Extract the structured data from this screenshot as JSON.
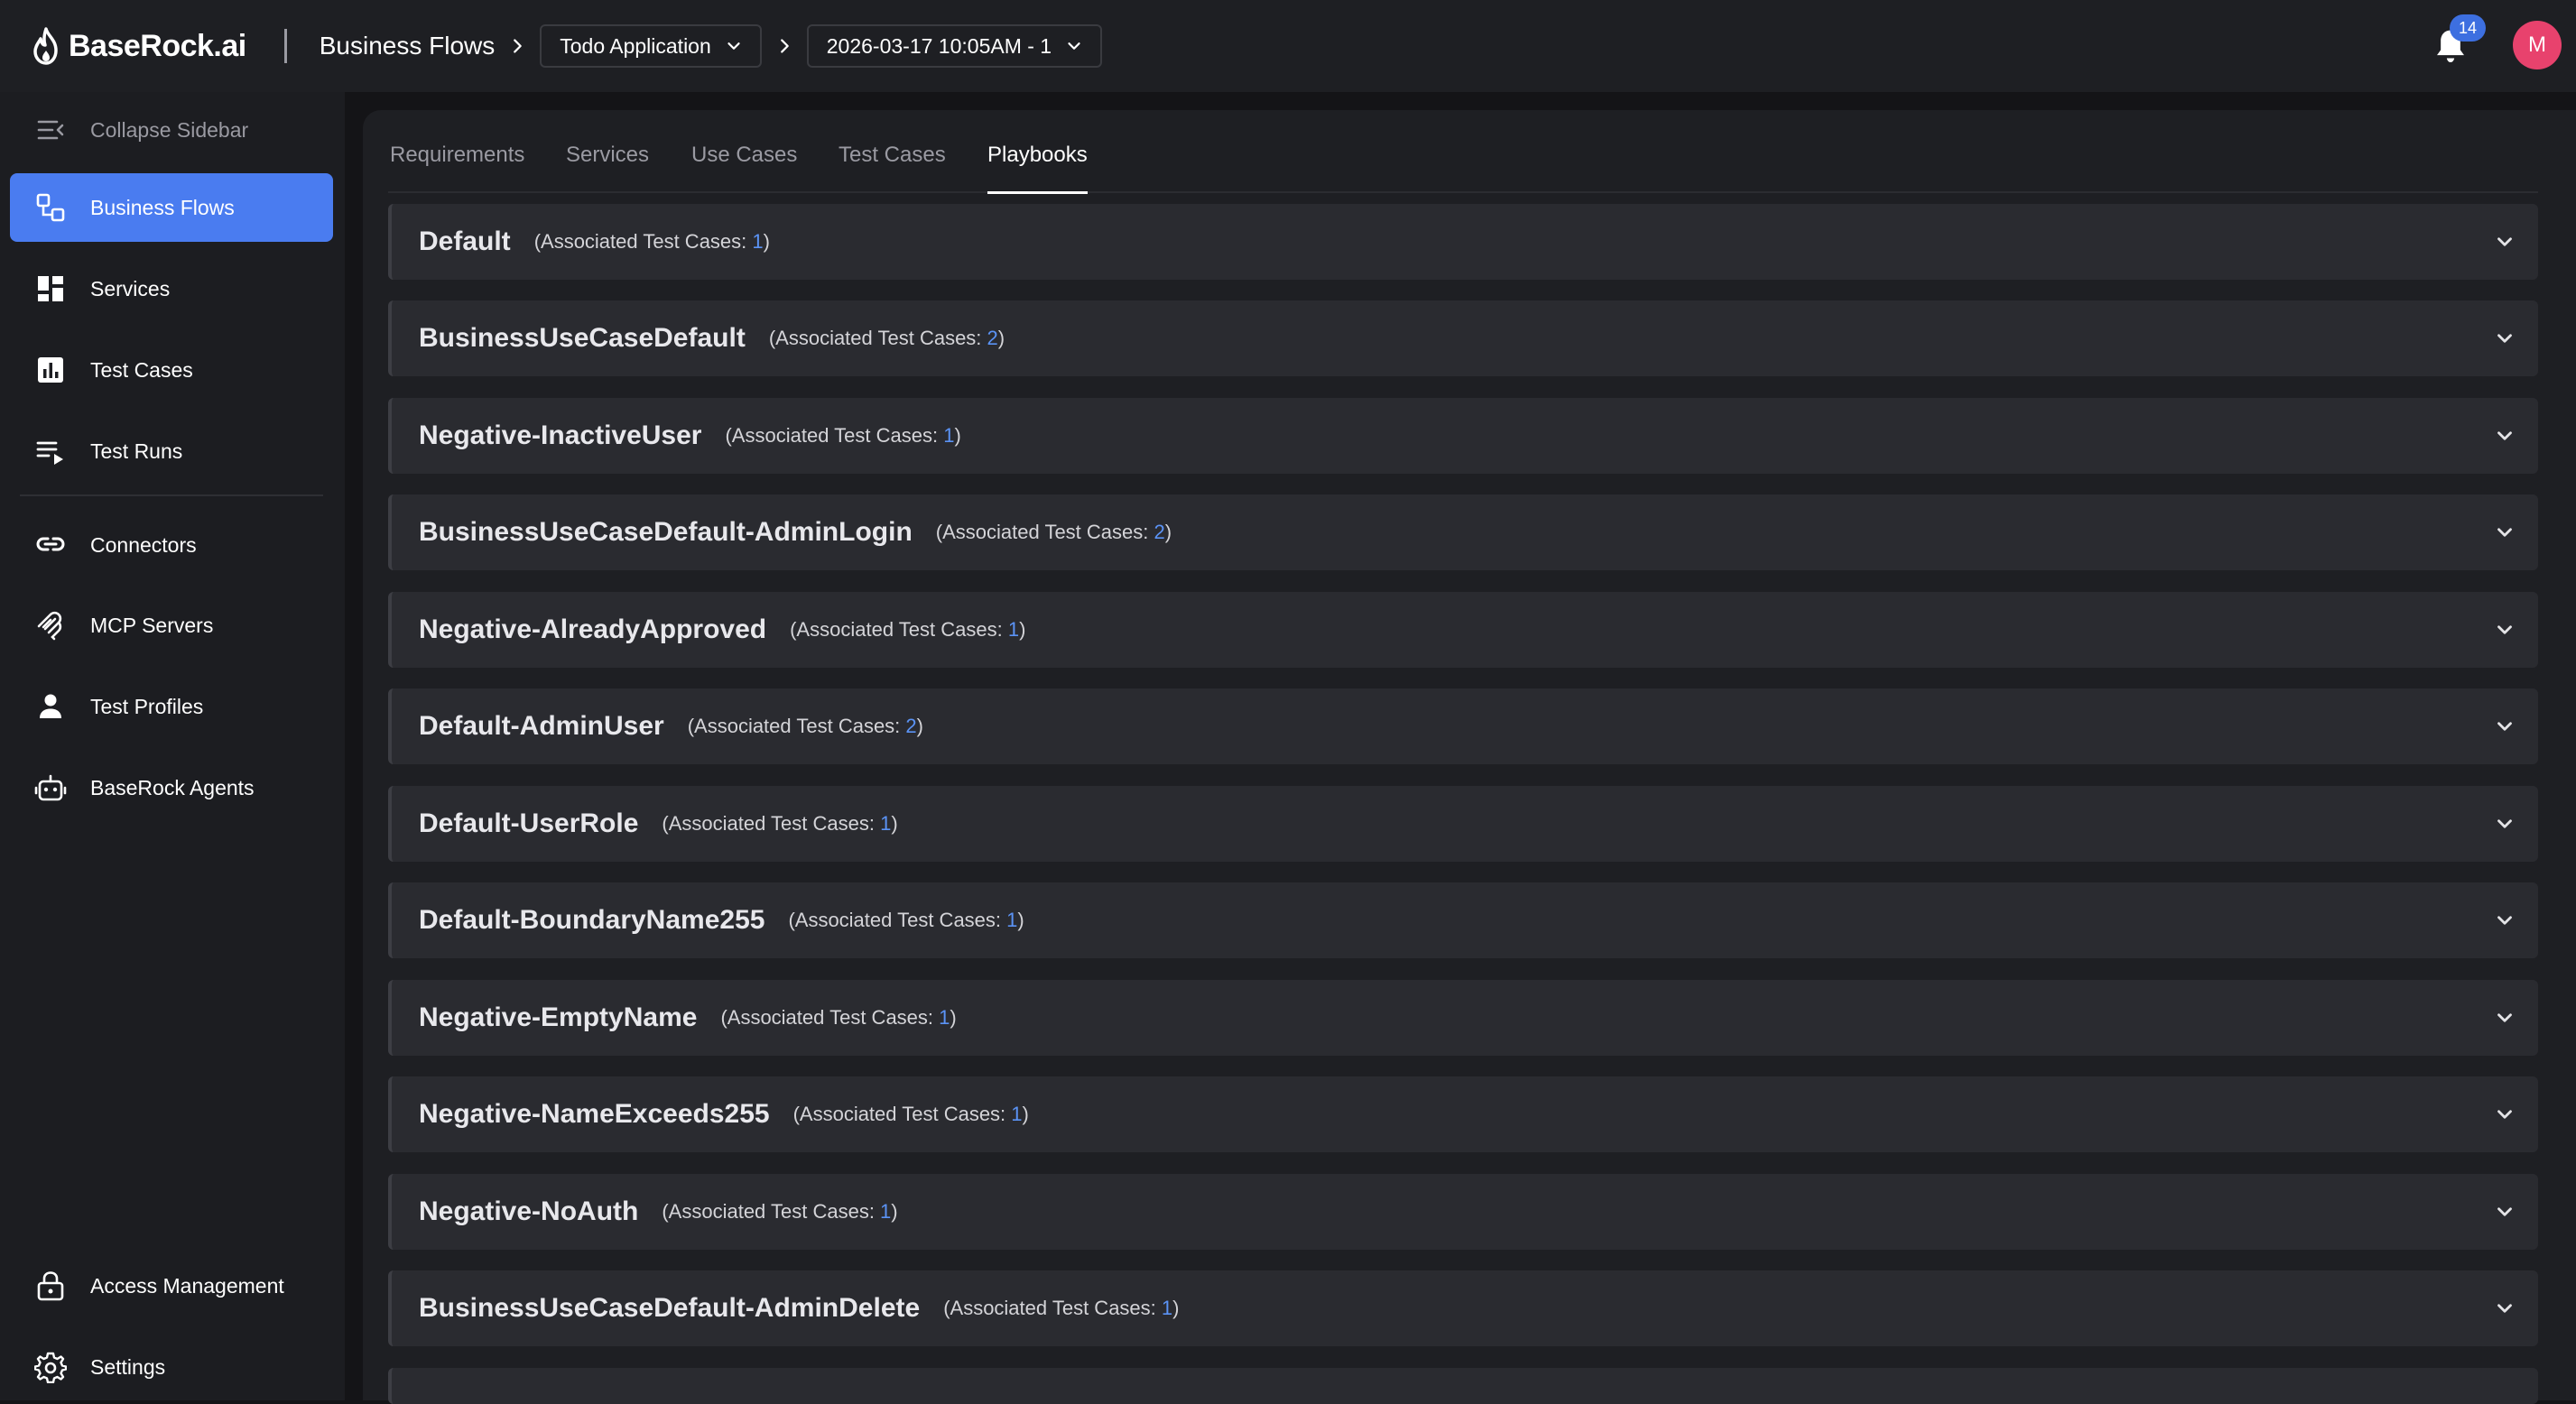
{
  "app": {
    "logo_text": "BaseRock.ai"
  },
  "breadcrumb": {
    "section": "Business Flows",
    "application": "Todo Application",
    "run": "2026-03-17 10:05AM - 1"
  },
  "header": {
    "notification_count": "14",
    "avatar_initial": "M"
  },
  "sidebar": {
    "collapse_label": "Collapse Sidebar",
    "items": [
      {
        "label": "Business Flows",
        "icon": "business-flows-icon"
      },
      {
        "label": "Services",
        "icon": "grid-icon"
      },
      {
        "label": "Test Cases",
        "icon": "chart-icon"
      },
      {
        "label": "Test Runs",
        "icon": "playlist-icon"
      },
      {
        "label": "Connectors",
        "icon": "link-icon"
      },
      {
        "label": "MCP Servers",
        "icon": "mcp-icon"
      },
      {
        "label": "Test Profiles",
        "icon": "person-icon"
      },
      {
        "label": "BaseRock Agents",
        "icon": "robot-icon"
      }
    ],
    "bottom_items": [
      {
        "label": "Access Management",
        "icon": "lock-icon"
      },
      {
        "label": "Settings",
        "icon": "gear-icon"
      }
    ]
  },
  "tabs": [
    {
      "label": "Requirements",
      "active": false
    },
    {
      "label": "Services",
      "active": false
    },
    {
      "label": "Use Cases",
      "active": false
    },
    {
      "label": "Test Cases",
      "active": false
    },
    {
      "label": "Playbooks",
      "active": true
    }
  ],
  "playbooks": {
    "assoc_prefix": "(Associated Test Cases: ",
    "assoc_suffix": ")",
    "items": [
      {
        "name": "Default",
        "count": "1"
      },
      {
        "name": "BusinessUseCaseDefault",
        "count": "2"
      },
      {
        "name": "Negative-InactiveUser",
        "count": "1"
      },
      {
        "name": "BusinessUseCaseDefault-AdminLogin",
        "count": "2"
      },
      {
        "name": "Negative-AlreadyApproved",
        "count": "1"
      },
      {
        "name": "Default-AdminUser",
        "count": "2"
      },
      {
        "name": "Default-UserRole",
        "count": "1"
      },
      {
        "name": "Default-BoundaryName255",
        "count": "1"
      },
      {
        "name": "Negative-EmptyName",
        "count": "1"
      },
      {
        "name": "Negative-NameExceeds255",
        "count": "1"
      },
      {
        "name": "Negative-NoAuth",
        "count": "1"
      },
      {
        "name": "BusinessUseCaseDefault-AdminDelete",
        "count": "1"
      }
    ]
  },
  "colors": {
    "accent": "#4a7cf0",
    "count_link": "#5b93f5",
    "avatar": "#e8426d",
    "badge": "#3d6fe0"
  }
}
